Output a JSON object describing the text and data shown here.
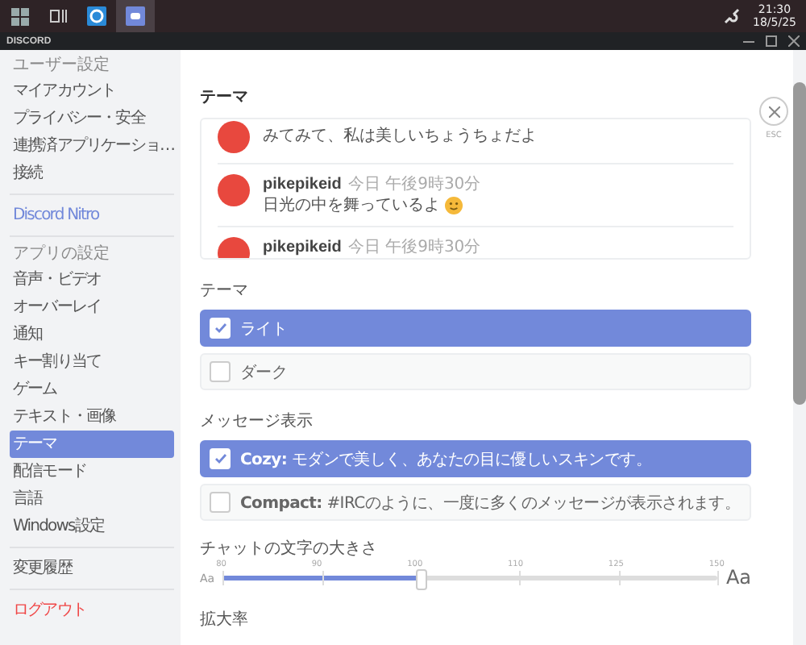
{
  "taskbar": {
    "apps": [
      {
        "kind": "start",
        "selected": false
      },
      {
        "kind": "taskview",
        "selected": false
      },
      {
        "kind": "browser",
        "selected": false
      },
      {
        "kind": "chat",
        "selected": true
      }
    ],
    "time": "21:30",
    "date": "18/5/25"
  },
  "window": {
    "title": "DISCORD"
  },
  "sidebar": {
    "sections": [
      {
        "header": "ユーザー設定",
        "items": [
          {
            "label": "マイアカウント",
            "kind": "normal",
            "selected": false
          },
          {
            "label": "プライバシー・安全",
            "kind": "normal",
            "selected": false
          },
          {
            "label": "連携済アプリケーショ…",
            "kind": "normal",
            "selected": false
          },
          {
            "label": "接続",
            "kind": "normal",
            "selected": false
          }
        ]
      },
      {
        "items": [
          {
            "label": "Discord Nitro",
            "kind": "nitro",
            "selected": false
          }
        ]
      },
      {
        "header": "アプリの設定",
        "items": [
          {
            "label": "音声・ビデオ",
            "kind": "normal",
            "selected": false
          },
          {
            "label": "オーバーレイ",
            "kind": "normal",
            "selected": false
          },
          {
            "label": "通知",
            "kind": "normal",
            "selected": false
          },
          {
            "label": "キー割り当て",
            "kind": "normal",
            "selected": false
          },
          {
            "label": "ゲーム",
            "kind": "normal",
            "selected": false
          },
          {
            "label": "テキスト・画像",
            "kind": "normal",
            "selected": false
          },
          {
            "label": "テーマ",
            "kind": "normal",
            "selected": true
          },
          {
            "label": "配信モード",
            "kind": "normal",
            "selected": false
          },
          {
            "label": "言語",
            "kind": "normal",
            "selected": false
          },
          {
            "label": "Windows設定",
            "kind": "normal",
            "selected": false
          }
        ]
      },
      {
        "items": [
          {
            "label": "変更履歴",
            "kind": "normal",
            "selected": false
          }
        ]
      },
      {
        "items": [
          {
            "label": "ログアウト",
            "kind": "danger",
            "selected": false
          }
        ]
      }
    ]
  },
  "page": {
    "title": "テーマ",
    "close_label": "ESC"
  },
  "preview_messages": [
    {
      "text": "みてみて、私は美しいちょうちょだよ"
    },
    {
      "username": "pikepikeid",
      "timestamp": "今日 午後9時30分",
      "text": "日光の中を舞っているよ",
      "emoji": true
    },
    {
      "username": "pikepikeid",
      "timestamp": "今日 午後9時30分"
    }
  ],
  "theme": {
    "label": "テーマ",
    "options": [
      {
        "label": "ライト",
        "selected": true
      },
      {
        "label": "ダーク",
        "selected": false
      }
    ]
  },
  "message_display": {
    "label": "メッセージ表示",
    "options": [
      {
        "label": "**Cozy:** モダンで美しく、あなたの目に優しいスキンです。",
        "selected": true
      },
      {
        "label": "**Compact:** #IRCのように、一度に多くのメッセージが表示されます。",
        "selected": false
      }
    ]
  },
  "font_size": {
    "label": "チャットの文字の大きさ",
    "ticks": [
      "80",
      "90",
      "100",
      "110",
      "125",
      "150"
    ],
    "level": 0.4,
    "small_label": "Aa",
    "large_label": "Aa"
  },
  "zoom": {
    "label": "拡大率"
  }
}
